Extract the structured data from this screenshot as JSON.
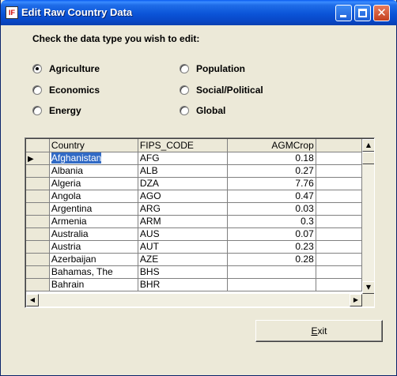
{
  "window": {
    "title": "Edit Raw Country Data",
    "app_icon_text": "IF"
  },
  "prompt": "Check the data type you wish to edit:",
  "radios": [
    {
      "label": "Agriculture",
      "checked": true
    },
    {
      "label": "Economics",
      "checked": false
    },
    {
      "label": "Energy",
      "checked": false
    },
    {
      "label": "Population",
      "checked": false
    },
    {
      "label": "Social/Political",
      "checked": false
    },
    {
      "label": "Global",
      "checked": false
    }
  ],
  "grid": {
    "columns": [
      "Country",
      "FIPS_CODE",
      "AGMCrop"
    ],
    "rows": [
      [
        "Afghanistan",
        "AFG",
        "0.18"
      ],
      [
        "Albania",
        "ALB",
        "0.27"
      ],
      [
        "Algeria",
        "DZA",
        "7.76"
      ],
      [
        "Angola",
        "AGO",
        "0.47"
      ],
      [
        "Argentina",
        "ARG",
        "0.03"
      ],
      [
        "Armenia",
        "ARM",
        "0.3"
      ],
      [
        "Australia",
        "AUS",
        "0.07"
      ],
      [
        "Austria",
        "AUT",
        "0.23"
      ],
      [
        "Azerbaijan",
        "AZE",
        "0.28"
      ],
      [
        "Bahamas, The",
        "BHS",
        ""
      ],
      [
        "Bahrain",
        "BHR",
        ""
      ]
    ],
    "current_row_indicator": "▶"
  },
  "buttons": {
    "exit_prefix": "E",
    "exit_rest": "xit"
  }
}
